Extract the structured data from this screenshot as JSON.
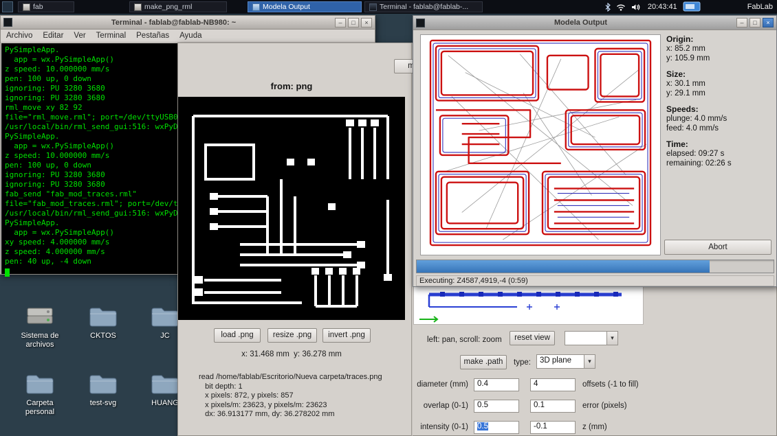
{
  "colors": {
    "taskbar_active": "#2f62a8",
    "terminal_green": "#00e000",
    "trace_red": "#cc1111",
    "trace_blue": "#3333bb",
    "path_blue": "#2a3fd4",
    "progress_fill": "#3f87cf",
    "selection_blue": "#3875d7"
  },
  "glyphs": {
    "minimize": "–",
    "maximize": "□",
    "close": "×",
    "arrow": "▾"
  },
  "taskbar": {
    "buttons": [
      {
        "label": "fab",
        "active": false
      },
      {
        "label": "make_png_rml",
        "active": false
      },
      {
        "label": "Modela Output",
        "active": true
      },
      {
        "label": "Terminal - fablab@fablab-...",
        "active": false
      }
    ],
    "clock": "20:43:41",
    "workspace_label": "FabLab"
  },
  "terminal": {
    "title": "Terminal - fablab@fablab-NB980: ~",
    "menu": [
      "Archivo",
      "Editar",
      "Ver",
      "Terminal",
      "Pestañas",
      "Ayuda"
    ],
    "lines": [
      "PySimpleApp.",
      "  app = wx.PySimpleApp()",
      "z speed: 10.000000 mm/s",
      "pen: 100 up, 0 down",
      "ignoring: PU 3280 3680",
      "ignoring: PU 3280 3680",
      "rml_move xy 82 92",
      "file=\"rml_move.rml\"; port=/dev/ttyUSB0",
      "/usr/local/bin/rml_send_gui:516: wxPyD",
      "PySimpleApp.",
      "  app = wx.PySimpleApp()",
      "z speed: 10.000000 mm/s",
      "pen: 100 up, 0 down",
      "ignoring: PU 3280 3680",
      "ignoring: PU 3280 3680",
      "fab_send \"fab_mod_traces.rml\"",
      "file=\"fab_mod_traces.rml\"; port=/dev/t",
      "/usr/local/bin/rml_send_gui:516: wxPyD",
      "PySimpleApp.",
      "  app = wx.PySimpleApp()",
      "xy speed: 4.000000 mm/s",
      "z speed: 4.000000 mm/s",
      "pen: 40 up, -4 down"
    ]
  },
  "desktop": {
    "icons": [
      {
        "label": "Sistema de archivos",
        "kind": "drive"
      },
      {
        "label": "CKTOS",
        "kind": "folder"
      },
      {
        "label": "JC",
        "kind": "folder"
      },
      {
        "label": "Carpeta personal",
        "kind": "folder"
      },
      {
        "label": "test-svg",
        "kind": "folder"
      },
      {
        "label": "HUANG",
        "kind": "folder"
      }
    ]
  },
  "png_window": {
    "mill_button": "mill t",
    "heading": "from: png",
    "load_button": "load .png",
    "resize_button": "resize .png",
    "invert_button": "invert .png",
    "coords": "x: 31.468 mm  y: 36.278 mm",
    "info_lines": [
      "read /home/fablab/Escritorio/Nueva carpeta/traces.png",
      "   bit depth: 1",
      "   x pixels: 872, y pixels: 857",
      "   x pixels/m: 23623, y pixels/m: 23623",
      "   dx: 36.913177 mm, dy: 36.278202 mm"
    ]
  },
  "path_panel": {
    "hint": "left: pan, scroll: zoom",
    "reset_view_button": "reset view",
    "view_select_value": "",
    "make_path_button": "make .path",
    "type_label": "type:",
    "type_value": "3D plane",
    "rows": [
      {
        "label": "diameter (mm)",
        "value1": "0.4",
        "value2": "4",
        "label2": "offsets (-1 to fill)"
      },
      {
        "label": "overlap (0-1)",
        "value1": "0.5",
        "value2": "0.1",
        "label2": "error (pixels)"
      },
      {
        "label": "intensity (0-1)",
        "value1": "0.5",
        "value2": "-0.1",
        "label2": "z (mm)"
      }
    ]
  },
  "modela": {
    "title": "Modela Output",
    "panel": {
      "origin_heading": "Origin:",
      "origin_x": "x: 85.2 mm",
      "origin_y": "y: 105.9 mm",
      "size_heading": "Size:",
      "size_x": "x: 30.1 mm",
      "size_y": "y: 29.1 mm",
      "speeds_heading": "Speeds:",
      "plunge": "plunge: 4.0 mm/s",
      "feed": "feed: 4.0 mm/s",
      "time_heading": "Time:",
      "elapsed": "elapsed: 09:27 s",
      "remaining": "remaining: 02:26 s"
    },
    "abort_button": "Abort",
    "progress_percent": 82,
    "status": "Executing: Z4587,4919,-4 (0:59)"
  }
}
